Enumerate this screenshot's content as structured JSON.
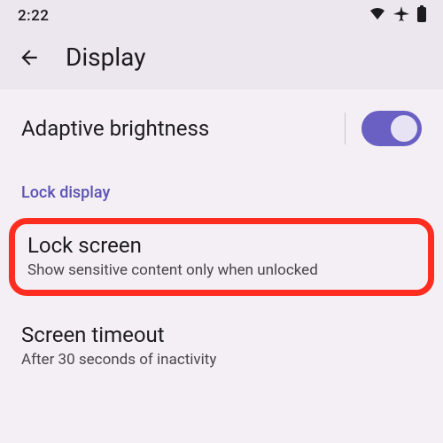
{
  "status_bar": {
    "time": "2:22"
  },
  "header": {
    "title": "Display"
  },
  "adaptive": {
    "label": "Adaptive brightness",
    "toggle_on": true
  },
  "section": {
    "lock_display": "Lock display"
  },
  "lock_screen": {
    "title": "Lock screen",
    "subtitle": "Show sensitive content only when unlocked"
  },
  "screen_timeout": {
    "title": "Screen timeout",
    "subtitle": "After 30 seconds of inactivity"
  }
}
